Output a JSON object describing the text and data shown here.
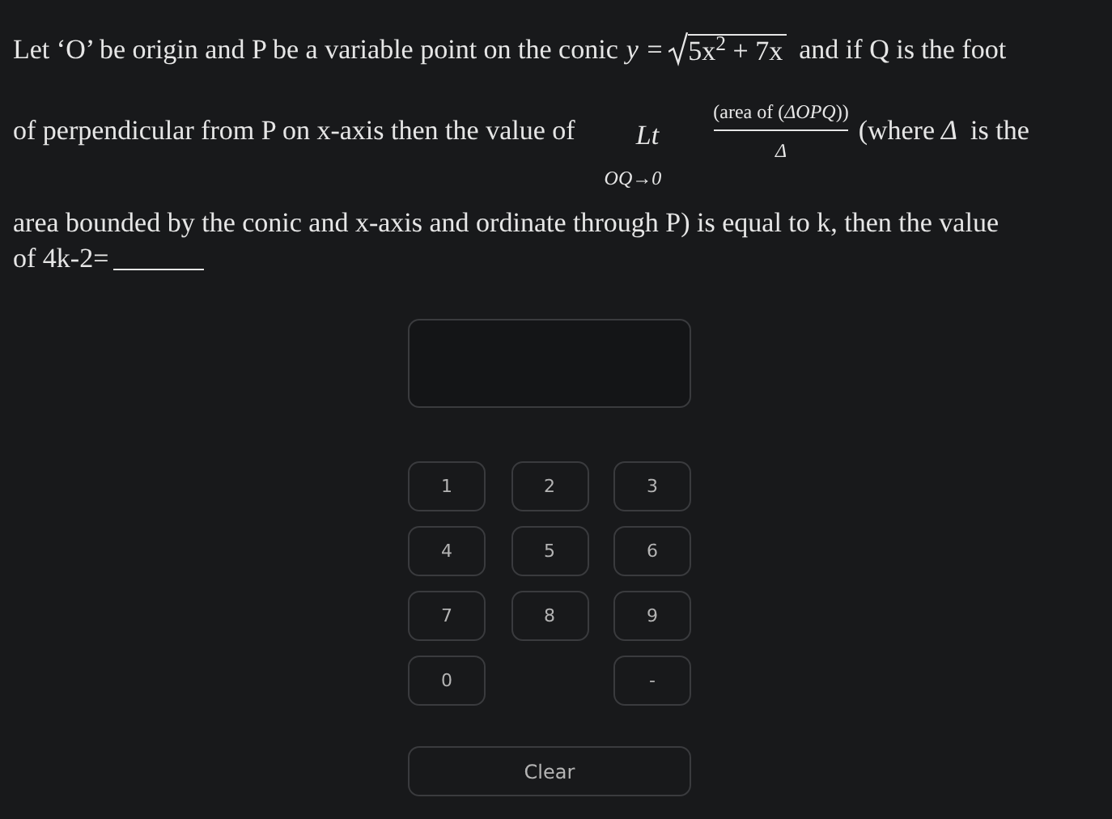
{
  "question": {
    "line1_before": "Let ‘O’ be origin and P be a variable point on the conic",
    "conic_lhs": "y =",
    "conic_radicand": "5x$^{2}$ + 7x",
    "line1_after": "and if Q is the foot",
    "line2_before": "of perpendicular from P on x-axis then the value of",
    "limit_operator": "Lt",
    "limit_subscript": "OQ→0",
    "fraction_numerator": "(area of (*ΔOPQ*))",
    "fraction_denominator": "Δ",
    "where_text": "(where",
    "delta_symbol": "Δ",
    "where_after": "is the",
    "line3": "area bounded by the conic and x-axis and ordinate through P) is equal to k, then the value",
    "line4": "of 4k-2="
  },
  "keypad": {
    "rows": [
      [
        {
          "kind": "key",
          "label": "1"
        },
        {
          "kind": "key",
          "label": "2"
        },
        {
          "kind": "key",
          "label": "3"
        }
      ],
      [
        {
          "kind": "key",
          "label": "4"
        },
        {
          "kind": "key",
          "label": "5"
        },
        {
          "kind": "key",
          "label": "6"
        }
      ],
      [
        {
          "kind": "key",
          "label": "7"
        },
        {
          "kind": "key",
          "label": "8"
        },
        {
          "kind": "key",
          "label": "9"
        }
      ],
      [
        {
          "kind": "key",
          "label": "0"
        },
        {
          "kind": "gap"
        },
        {
          "kind": "key",
          "label": "-"
        }
      ]
    ],
    "clear_label": "Clear"
  }
}
